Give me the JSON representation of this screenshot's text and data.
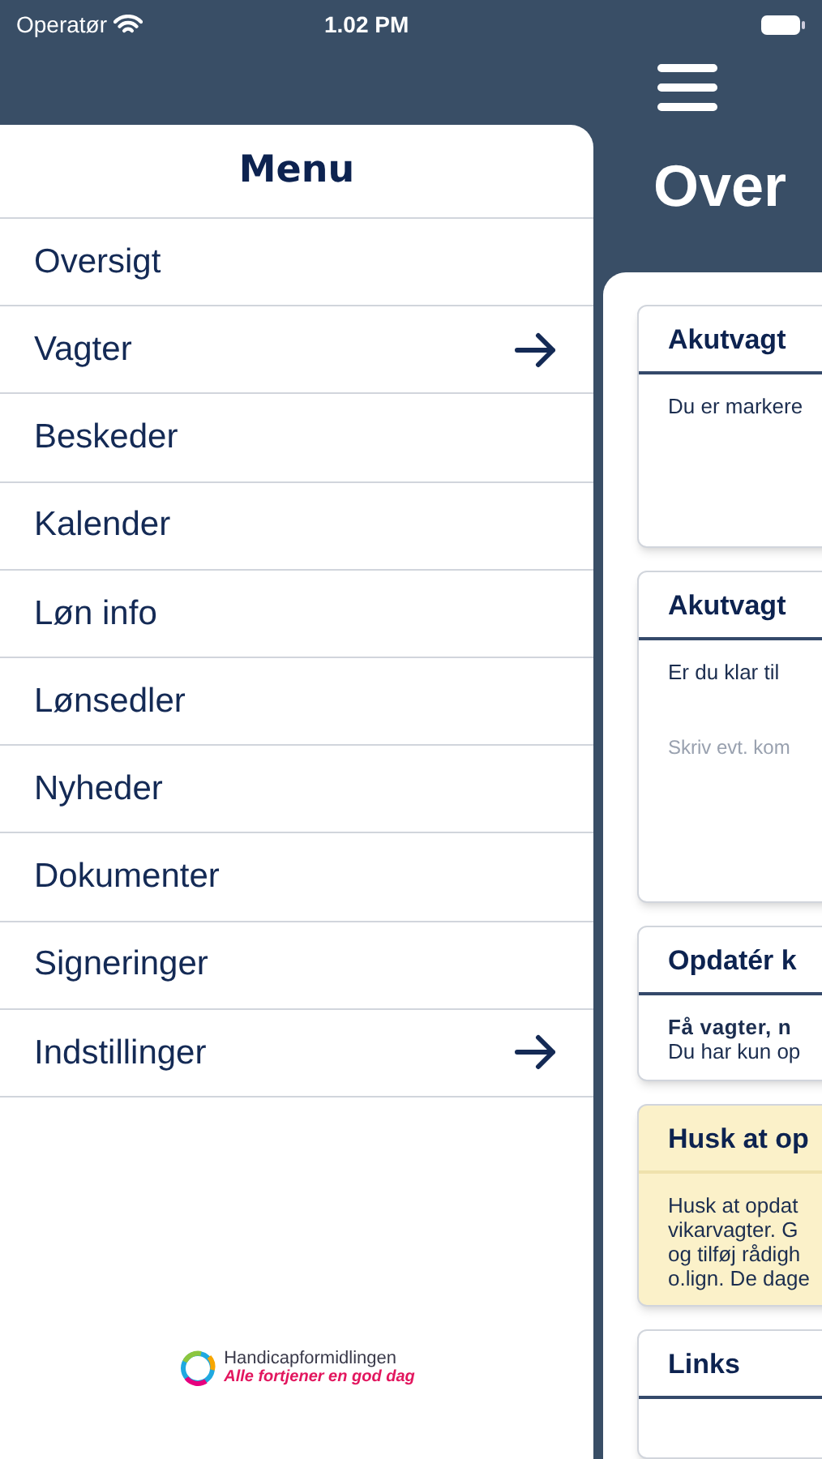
{
  "status_bar": {
    "carrier": "Operatør",
    "time": "1.02 PM"
  },
  "menu": {
    "title": "Menu",
    "items": [
      {
        "label": "Oversigt",
        "has_submenu": false
      },
      {
        "label": "Vagter",
        "has_submenu": true
      },
      {
        "label": "Beskeder",
        "has_submenu": false
      },
      {
        "label": "Kalender",
        "has_submenu": false
      },
      {
        "label": "Løn info",
        "has_submenu": false
      },
      {
        "label": "Lønsedler",
        "has_submenu": false
      },
      {
        "label": "Nyheder",
        "has_submenu": false
      },
      {
        "label": "Dokumenter",
        "has_submenu": false
      },
      {
        "label": "Signeringer",
        "has_submenu": false
      },
      {
        "label": "Indstillinger",
        "has_submenu": true
      }
    ],
    "logo": {
      "name": "Handicapformidlingen",
      "tagline": "Alle fortjener en god dag"
    }
  },
  "page": {
    "title": "Over",
    "cards": [
      {
        "kind": "text",
        "title": "Akutvagt",
        "lines": [
          "Du er markere"
        ]
      },
      {
        "kind": "input",
        "title": "Akutvagt",
        "lines": [
          "Er du klar til"
        ],
        "placeholder": "Skriv evt. kom"
      },
      {
        "kind": "text",
        "title": "Opdatér k",
        "bold_line": "Få vagter, n",
        "lines": [
          "Du har kun op"
        ]
      },
      {
        "kind": "notice",
        "title": "Husk at op",
        "lines": [
          "Husk at opdat",
          "vikarvagter. G",
          "og tilføj rådigh",
          "o.lign. De dage"
        ]
      },
      {
        "kind": "text",
        "title": "Links"
      }
    ]
  }
}
